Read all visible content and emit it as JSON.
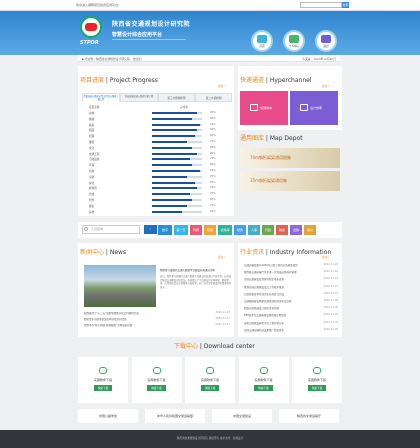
{
  "topbar": {
    "welcome": "欢迎进入顺畅项目综合应用平台！",
    "search_placeholder": "",
    "search_btn": "搜索"
  },
  "header": {
    "logo_text": "STPDR",
    "org": "陕西省交通规划设计研究院",
    "sub": "智慧设计综合应用平台"
  },
  "quick": [
    {
      "label": "首页",
      "color": "#3ab4dc"
    },
    {
      "label": "个人中心",
      "color": "#47b86a"
    },
    {
      "label": "退出",
      "color": "#6b5fd6"
    }
  ],
  "crumb": {
    "left": "▶ 欢迎你 / 陕西省交通规划设计研究院，欢迎您！",
    "right": "今天是：2020年12月20日"
  },
  "progress": {
    "title_cn": "项目进度",
    "title_en": "Project Progress",
    "more": "更多>",
    "tabs": [
      "西镇高速公路延长至天华段公路施工图工程",
      "西安绕城高速公路改扩建工程",
      "第三方检验检测",
      "第二大桥检测"
    ],
    "head_name": "项目名称",
    "head_rate": "完成率",
    "rows": [
      {
        "name": "总体",
        "rate": "90%",
        "v": 0.9
      },
      {
        "name": "路线",
        "rate": "80%",
        "v": 0.8
      },
      {
        "name": "路基",
        "rate": "95%",
        "v": 0.95
      },
      {
        "name": "路面",
        "rate": "90%",
        "v": 0.9
      },
      {
        "name": "桥涵",
        "rate": "85%",
        "v": 0.85
      },
      {
        "name": "隧道",
        "rate": "70%",
        "v": 0.7
      },
      {
        "name": "交叉",
        "rate": "80%",
        "v": 0.8
      },
      {
        "name": "交通工程",
        "rate": "90%",
        "v": 0.9
      },
      {
        "name": "沿线设施",
        "rate": "75%",
        "v": 0.75
      },
      {
        "name": "环保",
        "rate": "80%",
        "v": 0.8
      },
      {
        "name": "机电",
        "rate": "95%",
        "v": 0.95
      },
      {
        "name": "房建",
        "rate": "70%",
        "v": 0.7
      },
      {
        "name": "绿化",
        "rate": "85%",
        "v": 0.85
      },
      {
        "name": "概预算",
        "rate": "90%",
        "v": 0.9
      },
      {
        "name": "管线",
        "rate": "75%",
        "v": 0.75
      },
      {
        "name": "附件",
        "rate": "80%",
        "v": 0.8
      },
      {
        "name": "图表",
        "rate": "70%",
        "v": 0.7
      },
      {
        "name": "其他",
        "rate": "60%",
        "v": 0.6
      }
    ]
  },
  "hyper": {
    "title_cn": "快速通道",
    "title_en": "Hyperchannel",
    "more": "更多>",
    "items": [
      {
        "label": "智慧成本",
        "color": "#e84b8a"
      },
      {
        "label": "设计效率",
        "color": "#7b5ed6"
      }
    ]
  },
  "mapdepot": {
    "title_cn": "通用图库",
    "title_en": "Map Depot",
    "items": [
      {
        "label": "70m钢桁架梁通用图集"
      },
      {
        "label": "35m钢桁架梁通用集"
      }
    ]
  },
  "nav": {
    "search_placeholder": "人员查询",
    "items": [
      {
        "label": "数字",
        "color": "#2a8fd4"
      },
      {
        "label": "第一天",
        "color": "#3ab5e4"
      },
      {
        "label": "科研",
        "color": "#e95a7a"
      },
      {
        "label": "营销",
        "color": "#f2a23b"
      },
      {
        "label": "资料库",
        "color": "#2fb39a"
      },
      {
        "label": "财务",
        "color": "#4a9ce8"
      },
      {
        "label": "人事",
        "color": "#3fb0c8"
      },
      {
        "label": "行政",
        "color": "#6aa84f"
      },
      {
        "label": "物资",
        "color": "#d9645a"
      },
      {
        "label": "出纳",
        "color": "#8e6bd1"
      },
      {
        "label": "造价",
        "color": "#e6a23c"
      }
    ]
  },
  "news": {
    "title_cn": "新闻中心",
    "title_en": "News",
    "more": "更多>",
    "feature_title": "我院参与编制的交通大数据平台建设标准通过评审",
    "feature_body": "近日，我院参与编制的交通大数据平台建设标准通过专家评审，标准结合陕西交通建设实际情况，系统提出了平台建设的总体框架、数据资源、应用服务及安全保障等方面要求，对行业信息化建设具有重要指导意义。",
    "items": [
      {
        "t": "陕西省首个\"十三五\"规划项目数字化交付顺利完成",
        "d": "2020-11-18"
      },
      {
        "t": "我院青年志愿者参加冬季扶贫慰问活动",
        "d": "2020-11-11"
      },
      {
        "t": "我院举办\"匠心筑路 智慧赋能\"主题演讲比赛",
        "d": "2020-10-27"
      }
    ]
  },
  "industry": {
    "title_cn": "行业资讯",
    "title_en": "Industry Information",
    "more": "更多>",
    "items": [
      {
        "t": "交通运输部发布2020年公路工程造价依据新规定",
        "d": "2020-11-18"
      },
      {
        "t": "陕西省交通运输厅关于进一步加强公路养护管理",
        "d": "2020-11-16"
      },
      {
        "t": "全国公路建设投资保持稳定增长态势",
        "d": "2020-11-14"
      },
      {
        "t": "智慧高速公路建设试点工作稳步推进",
        "d": "2020-11-12"
      },
      {
        "t": "公路桥梁技术状况评定标准修订完成",
        "d": "2020-11-10"
      },
      {
        "t": "交通强国建设纲要实施情况新闻发布会召开",
        "d": "2020-11-08"
      },
      {
        "t": "新版公路路线设计规范正式实施",
        "d": "2020-11-05"
      },
      {
        "t": "BIM技术在交通基础设施领域应用加快",
        "d": "2020-11-02"
      },
      {
        "t": "绿色公路建设典型示范工程名单公布",
        "d": "2020-10-30"
      },
      {
        "t": "全国交通运输科技成果推广目录发布",
        "d": "2020-10-28"
      }
    ]
  },
  "download": {
    "title_cn": "下载中心",
    "title_en": "Download center",
    "btn": "快速下载",
    "items": [
      {
        "label": "实用软件下载"
      },
      {
        "label": "实用软件下载"
      },
      {
        "label": "实用软件下载"
      },
      {
        "label": "实用软件下载"
      },
      {
        "label": "实用软件下载"
      }
    ]
  },
  "partners": [
    {
      "label": "中国公路学会"
    },
    {
      "label": "中华人民共和国交通运输部"
    },
    {
      "label": "中国交通建设"
    },
    {
      "label": "陕西省交通运输厅"
    }
  ],
  "footer": {
    "text": "陕西省交通规划设计研究院 版权所有  技术支持：智慧设计"
  }
}
